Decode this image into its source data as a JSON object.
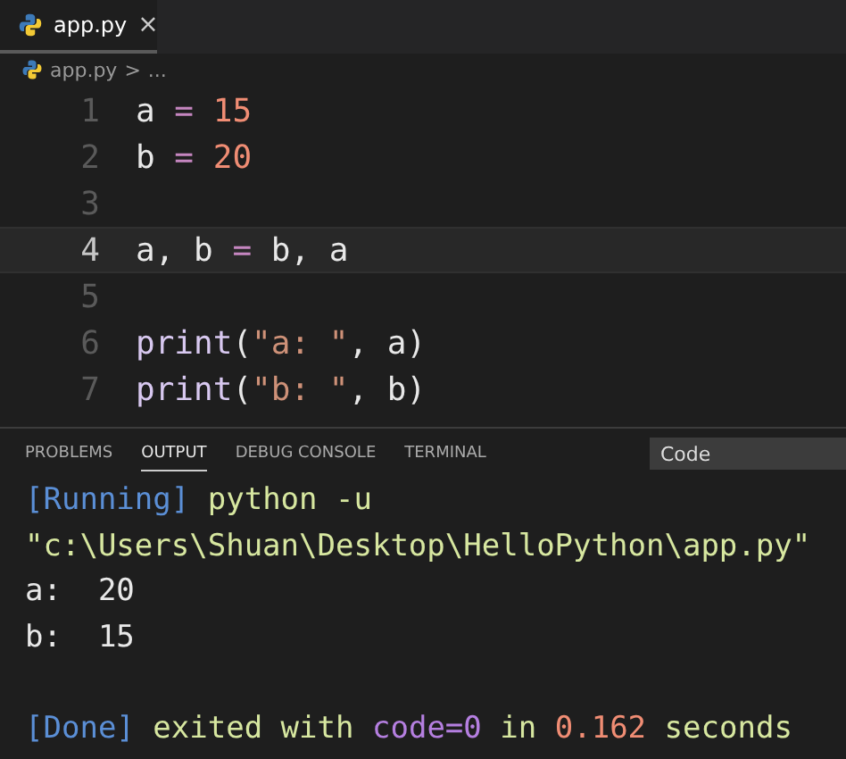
{
  "editor_tabs": [
    {
      "label": "app.py",
      "selected": true,
      "close": "×"
    }
  ],
  "breadcrumb": [
    "app.py",
    ">",
    "..."
  ],
  "code_lines": [
    {
      "number": "1",
      "current": false,
      "tokens": [
        {
          "kind": "ident",
          "text": "a"
        },
        {
          "kind": "op",
          "text": " = "
        },
        {
          "kind": "num",
          "text": "15"
        }
      ]
    },
    {
      "number": "2",
      "current": false,
      "tokens": [
        {
          "kind": "ident",
          "text": "b"
        },
        {
          "kind": "op",
          "text": " = "
        },
        {
          "kind": "num",
          "text": "20"
        }
      ]
    },
    {
      "number": "3",
      "current": false
    },
    {
      "number": "4",
      "current": true,
      "tokens": [
        {
          "kind": "ident",
          "text": "a, b"
        },
        {
          "kind": "op",
          "text": " = "
        },
        {
          "kind": "ident",
          "text": "b, a"
        }
      ]
    },
    {
      "number": "5",
      "current": false
    },
    {
      "number": "6",
      "current": false,
      "tokens": [
        {
          "kind": "fn",
          "text": "print"
        },
        {
          "kind": "ident",
          "text": "("
        },
        {
          "kind": "str",
          "text": "\"a: \""
        },
        {
          "kind": "ident",
          "text": ", a)"
        }
      ]
    },
    {
      "number": "7",
      "current": false,
      "tokens": [
        {
          "kind": "fn",
          "text": "print"
        },
        {
          "kind": "ident",
          "text": "("
        },
        {
          "kind": "str",
          "text": "\"b: \""
        },
        {
          "kind": "ident",
          "text": ", b)"
        }
      ]
    }
  ],
  "panel_tabs": [
    {
      "label": "PROBLEMS",
      "selected": false
    },
    {
      "label": "OUTPUT",
      "selected": true
    },
    {
      "label": "DEBUG CONSOLE",
      "selected": false
    },
    {
      "label": "TERMINAL",
      "selected": false
    }
  ],
  "output_channel": "Code",
  "output_lines": [
    {
      "kind": "text",
      "segments": [
        {
          "kind": "tag",
          "text": "[Running]"
        },
        {
          "kind": "cmd",
          "text": " python -u"
        }
      ]
    },
    {
      "kind": "text",
      "segments": [
        {
          "kind": "cmd",
          "text": "\"c:\\Users\\Shuan\\Desktop\\HelloPython\\app.py\""
        }
      ]
    },
    {
      "kind": "text",
      "segments": [
        {
          "kind": "plain",
          "text": "a:  20"
        }
      ]
    },
    {
      "kind": "text",
      "segments": [
        {
          "kind": "plain",
          "text": "b:  15"
        }
      ]
    },
    {
      "kind": "blank"
    },
    {
      "kind": "text",
      "segments": [
        {
          "kind": "tag",
          "text": "[Done]"
        },
        {
          "kind": "cmd",
          "text": " exited with "
        },
        {
          "kind": "kw",
          "text": "code=0"
        },
        {
          "kind": "cmd",
          "text": " in "
        },
        {
          "kind": "num",
          "text": "0.162"
        },
        {
          "kind": "cmd",
          "text": " seconds"
        }
      ]
    }
  ]
}
